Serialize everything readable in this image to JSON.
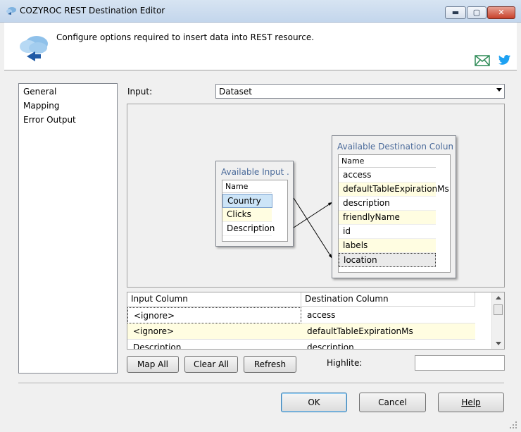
{
  "window": {
    "title": "COZYROC REST Destination Editor",
    "minimize": "▬",
    "maximize": "▢",
    "close": "✕"
  },
  "header": {
    "text": "Configure options required to insert data into REST resource."
  },
  "nav": {
    "items": [
      "General",
      "Mapping",
      "Error Output"
    ],
    "selected": "Mapping"
  },
  "input": {
    "label": "Input:",
    "value": "Dataset"
  },
  "input_box": {
    "title": "Available Input ...",
    "header": "Name",
    "columns": [
      "Country",
      "Clicks",
      "Description"
    ],
    "selected": "Country"
  },
  "dest_box": {
    "title": "Available Destination Colum...",
    "header": "Name",
    "columns": [
      "access",
      "defaultTableExpirationMs",
      "description",
      "friendlyName",
      "id",
      "labels",
      "location"
    ],
    "focused": "location"
  },
  "mappings": [
    {
      "from": "Country",
      "to": "location"
    },
    {
      "from": "Description",
      "to": "friendlyName"
    }
  ],
  "grid": {
    "headers": [
      "Input Column",
      "Destination Column"
    ],
    "rows": [
      {
        "input": "<ignore>",
        "dest": "access"
      },
      {
        "input": "<ignore>",
        "dest": "defaultTableExpirationMs"
      },
      {
        "input": "Description",
        "dest": "description"
      }
    ]
  },
  "buttons": {
    "map_all": "Map All",
    "clear_all": "Clear All",
    "refresh": "Refresh",
    "ok": "OK",
    "cancel": "Cancel",
    "help": "Help"
  },
  "highlite": {
    "label": "Highlite:",
    "value": ""
  },
  "colors": {
    "accent": "#4a6a9a",
    "alt_row": "#fffde1",
    "selection": "#cce4f7"
  }
}
